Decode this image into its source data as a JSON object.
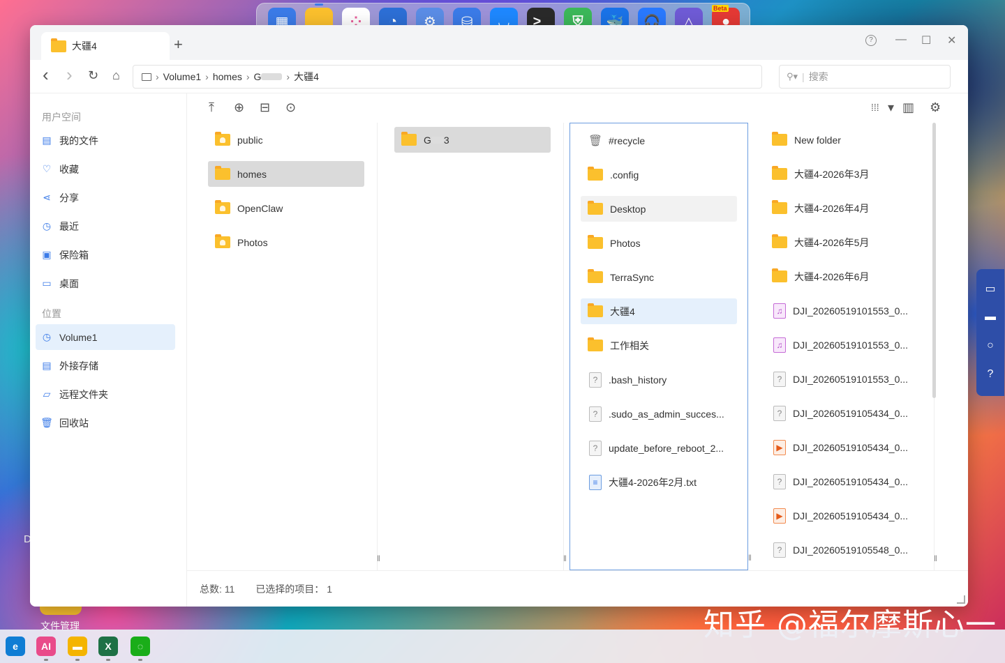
{
  "dock": {
    "apps": [
      {
        "name": "layout-app-icon",
        "color": "#3b7be8",
        "glyph": "▦",
        "running": false
      },
      {
        "name": "file-manager-icon",
        "color": "#fbc02d",
        "glyph": "",
        "running": true
      },
      {
        "name": "app-center-icon",
        "color": "#ffffff",
        "glyph": "⁘",
        "running": false
      },
      {
        "name": "backup-clock-icon",
        "color": "#2d6fd6",
        "glyph": "◔",
        "running": false
      },
      {
        "name": "settings-gear-icon",
        "color": "#5b8de6",
        "glyph": "⚙",
        "running": false
      },
      {
        "name": "storage-manager-icon",
        "color": "#3b7be8",
        "glyph": "⛁",
        "running": false
      },
      {
        "name": "store-bag-icon",
        "color": "#1e88ff",
        "glyph": "◡",
        "running": false
      },
      {
        "name": "terminal-icon",
        "color": "#2a2a2a",
        "glyph": ">_",
        "running": false
      },
      {
        "name": "security-shield-icon",
        "color": "#3cb85a",
        "glyph": "⛨",
        "running": false
      },
      {
        "name": "docker-icon",
        "color": "#1a73e8",
        "glyph": "🐳",
        "running": false
      },
      {
        "name": "support-headset-icon",
        "color": "#2979ff",
        "glyph": "🎧",
        "running": false
      },
      {
        "name": "ai-triangle-icon",
        "color": "#6f5bd6",
        "glyph": "△",
        "running": false
      },
      {
        "name": "beta-bird-icon",
        "color": "#e53935",
        "glyph": "●",
        "running": false,
        "badge": "Beta"
      }
    ]
  },
  "window": {
    "tab_title": "大疆4",
    "tab_add": "+",
    "help": "?",
    "minimize": "—",
    "maximize": "☐",
    "close": "✕"
  },
  "nav": {
    "back": "‹",
    "forward": "›",
    "refresh": "↻",
    "home": "⌂",
    "path": [
      "Volume1",
      "homes",
      "G",
      "大疆4"
    ],
    "search_placeholder": "搜索"
  },
  "sidebar": {
    "section_user": "用户空间",
    "user_items": [
      {
        "label": "我的文件",
        "icon": "file-icon",
        "glyph": "▤"
      },
      {
        "label": "收藏",
        "icon": "heart-icon",
        "glyph": "♡"
      },
      {
        "label": "分享",
        "icon": "share-icon",
        "glyph": "⋖"
      },
      {
        "label": "最近",
        "icon": "recent-clock-icon",
        "glyph": "◷"
      },
      {
        "label": "保险箱",
        "icon": "safe-icon",
        "glyph": "▣"
      },
      {
        "label": "桌面",
        "icon": "desktop-icon",
        "glyph": "▭"
      }
    ],
    "section_location": "位置",
    "location_items": [
      {
        "label": "Volume1",
        "icon": "volume-icon",
        "glyph": "◷",
        "active": true
      },
      {
        "label": "外接存储",
        "icon": "external-storage-icon",
        "glyph": "▤"
      },
      {
        "label": "远程文件夹",
        "icon": "remote-folder-icon",
        "glyph": "▱"
      },
      {
        "label": "回收站",
        "icon": "trash-icon",
        "glyph": "🗑"
      }
    ]
  },
  "toolbar": {
    "upload": "⤒",
    "new": "⊕",
    "properties": "⊟",
    "more": "⊙",
    "view_grid": "⁞⁞⁞",
    "view_dropdown": "▾",
    "view_columns": "▥",
    "settings": "⚙"
  },
  "columns": {
    "col1": [
      {
        "label": "public",
        "type": "folder-shared"
      },
      {
        "label": "homes",
        "type": "folder",
        "state": "sel"
      },
      {
        "label": "OpenClaw",
        "type": "folder-shared"
      },
      {
        "label": "Photos",
        "type": "folder-shared"
      }
    ],
    "col2": [
      {
        "label_prefix": "G",
        "label_suffix": "3",
        "type": "folder",
        "state": "sel"
      }
    ],
    "col3": [
      {
        "label": "#recycle",
        "type": "trash"
      },
      {
        "label": ".config",
        "type": "folder"
      },
      {
        "label": "Desktop",
        "type": "folder",
        "state": "hv"
      },
      {
        "label": "Photos",
        "type": "folder"
      },
      {
        "label": "TerraSync",
        "type": "folder"
      },
      {
        "label": "大疆4",
        "type": "folder",
        "state": "hl"
      },
      {
        "label": "工作相关",
        "type": "folder"
      },
      {
        "label": ".bash_history",
        "type": "unknown"
      },
      {
        "label": ".sudo_as_admin_succes...",
        "type": "unknown"
      },
      {
        "label": "update_before_reboot_2...",
        "type": "unknown"
      },
      {
        "label": "大疆4-2026年2月.txt",
        "type": "txt"
      }
    ],
    "col4": [
      {
        "label": "New folder",
        "type": "folder"
      },
      {
        "label": "大疆4-2026年3月",
        "type": "folder"
      },
      {
        "label": "大疆4-2026年4月",
        "type": "folder"
      },
      {
        "label": "大疆4-2026年5月",
        "type": "folder"
      },
      {
        "label": "大疆4-2026年6月",
        "type": "folder"
      },
      {
        "label": "DJI_20260519101553_0...",
        "type": "audio"
      },
      {
        "label": "DJI_20260519101553_0...",
        "type": "audio"
      },
      {
        "label": "DJI_20260519101553_0...",
        "type": "unknown"
      },
      {
        "label": "DJI_20260519105434_0...",
        "type": "unknown"
      },
      {
        "label": "DJI_20260519105434_0...",
        "type": "video"
      },
      {
        "label": "DJI_20260519105434_0...",
        "type": "unknown"
      },
      {
        "label": "DJI_20260519105434_0...",
        "type": "video"
      },
      {
        "label": "DJI_20260519105548_0...",
        "type": "unknown"
      }
    ]
  },
  "status": {
    "total": "总数: 11",
    "selected": "已选择的项目： 1"
  },
  "desktop": {
    "partial_label": "D",
    "file_manager_label": "文件管理",
    "watermark": "知乎 @福尔摩斯心一"
  },
  "taskbar": {
    "apps": [
      {
        "name": "edge-browser-icon",
        "color": "#0f7dd4",
        "glyph": "e"
      },
      {
        "name": "ai-assistant-icon",
        "color": "#e94b8a",
        "glyph": "AI"
      },
      {
        "name": "file-explorer-icon",
        "color": "#f4b400",
        "glyph": "▬"
      },
      {
        "name": "excel-icon",
        "color": "#1e7145",
        "glyph": "X"
      },
      {
        "name": "wechat-icon",
        "color": "#1aad19",
        "glyph": "◌"
      }
    ]
  },
  "float_panel": {
    "icons": [
      {
        "name": "monitor-chart-icon",
        "glyph": "▭"
      },
      {
        "name": "chat-icon",
        "glyph": "▬"
      },
      {
        "name": "search-icon",
        "glyph": "○"
      },
      {
        "name": "help-icon",
        "glyph": "?"
      }
    ]
  }
}
